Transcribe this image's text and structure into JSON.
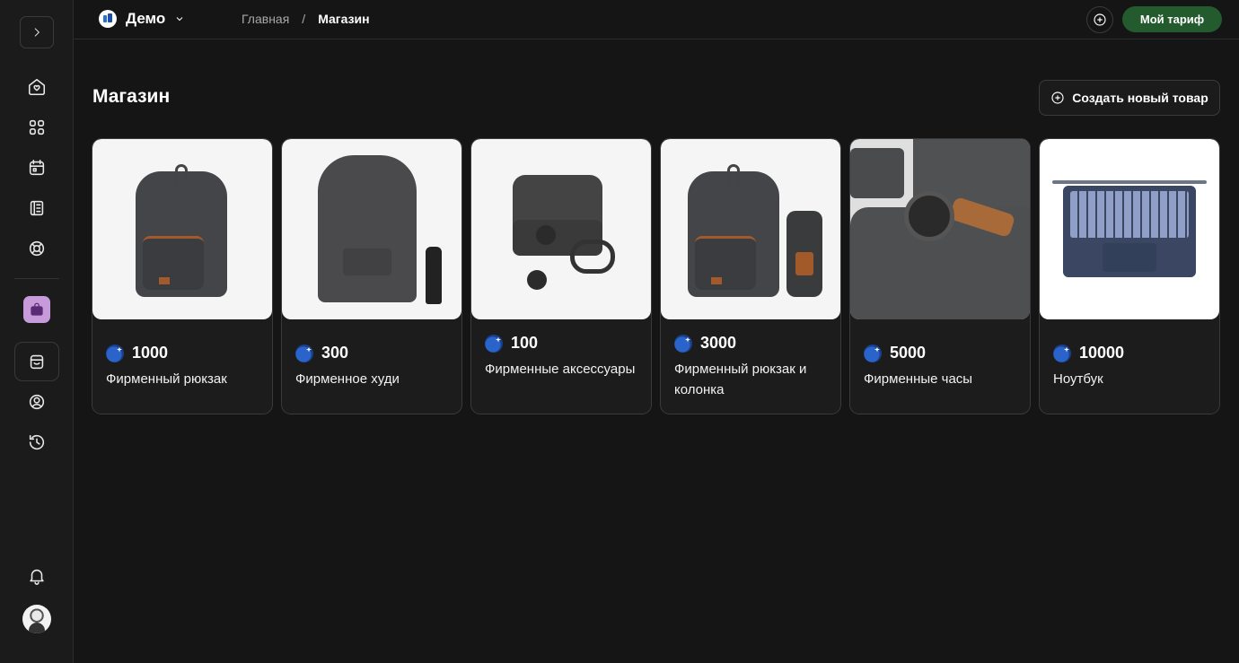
{
  "topbar": {
    "workspace": "Демо",
    "breadcrumb_home": "Главная",
    "breadcrumb_sep": "/",
    "breadcrumb_current": "Магазин",
    "plan_button": "Мой тариф"
  },
  "page": {
    "title": "Магазин",
    "create_button": "Создать новый товар"
  },
  "products": [
    {
      "price": "1000",
      "name": "Фирменный рюкзак",
      "image": "backpack"
    },
    {
      "price": "300",
      "name": "Фирменное худи",
      "image": "hoodie"
    },
    {
      "price": "100",
      "name": "Фирменные аксессуары",
      "image": "accessories"
    },
    {
      "price": "3000",
      "name": "Фирменный рюкзак и колонка",
      "image": "backpack-speaker"
    },
    {
      "price": "5000",
      "name": "Фирменные часы",
      "image": "watch"
    },
    {
      "price": "10000",
      "name": "Ноутбук",
      "image": "laptop"
    }
  ],
  "sidebar": {
    "icons": [
      "home-icon",
      "grid-icon",
      "calendar-icon",
      "ledger-icon",
      "lifebuoy-icon",
      "shopping-bag-icon",
      "store-icon",
      "user-circle-icon",
      "history-icon",
      "bell-icon"
    ]
  },
  "colors": {
    "background": "#161516",
    "plan_button": "#235a2e",
    "shop_accent": "#c79bd9",
    "coin": "#2a63c9"
  }
}
